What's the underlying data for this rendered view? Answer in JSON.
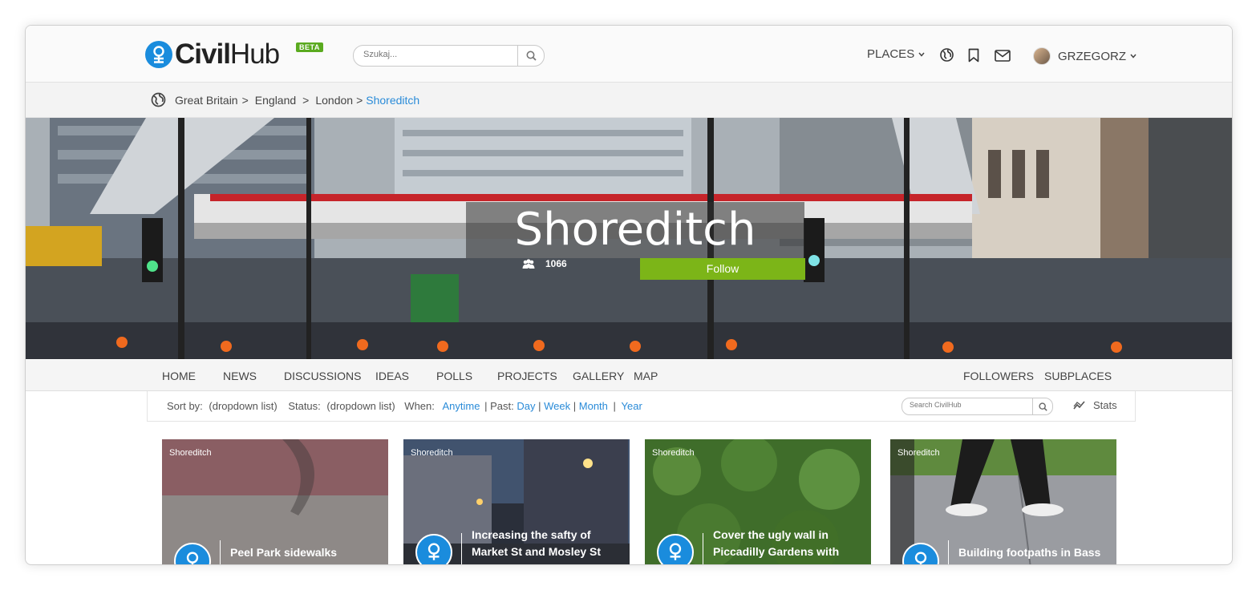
{
  "header": {
    "logo_civil": "Civil",
    "logo_hub": "Hub",
    "beta": "BETA",
    "search_placeholder": "Szukaj...",
    "places": "PLACES",
    "user_name": "GRZEGORZ"
  },
  "breadcrumb": {
    "items": [
      "Great Britain",
      "England",
      "London"
    ],
    "current": "Shoreditch",
    "separator": ">"
  },
  "hero": {
    "title": "Shoreditch",
    "followers_count": "1066",
    "follow_label": "Follow"
  },
  "tabs": {
    "left": [
      "HOME",
      "NEWS",
      "DISCUSSIONS",
      "IDEAS",
      "POLLS",
      "PROJECTS",
      "GALLERY",
      "MAP"
    ],
    "right": [
      "FOLLOWERS",
      "SUBPLACES"
    ]
  },
  "filter": {
    "sort_label": "Sort by:",
    "sort_value": "(dropdown list)",
    "status_label": "Status:",
    "status_value": "(dropdown list)",
    "when_label": "When:",
    "anytime": "Anytime",
    "past_label": "Past:",
    "day": "Day",
    "week": "Week",
    "month": "Month",
    "year": "Year",
    "pipe": "|",
    "search_placeholder": "Search CivilHub",
    "stats_label": "Stats"
  },
  "cards": [
    {
      "tag": "Shoreditch",
      "title": "Peel Park sidewalks"
    },
    {
      "tag": "Shoreditch",
      "title": "Increasing the safty of Market St and Mosley St"
    },
    {
      "tag": "Shoreditch",
      "title": "Cover the ugly wall in Piccadilly Gardens with"
    },
    {
      "tag": "Shoreditch",
      "title": "Building footpaths in Bass"
    }
  ],
  "colors": {
    "accent_blue": "#2a8bd8",
    "logo_blue": "#1a8cdd",
    "follow_green": "#7cb518",
    "beta_green": "#5aaa1f"
  },
  "icons": [
    "logo-person-icon",
    "search-icon",
    "chevron-down-icon",
    "globe-icon",
    "bookmark-icon",
    "mail-icon",
    "globe-places-icon",
    "people-icon",
    "stats-chart-icon"
  ]
}
